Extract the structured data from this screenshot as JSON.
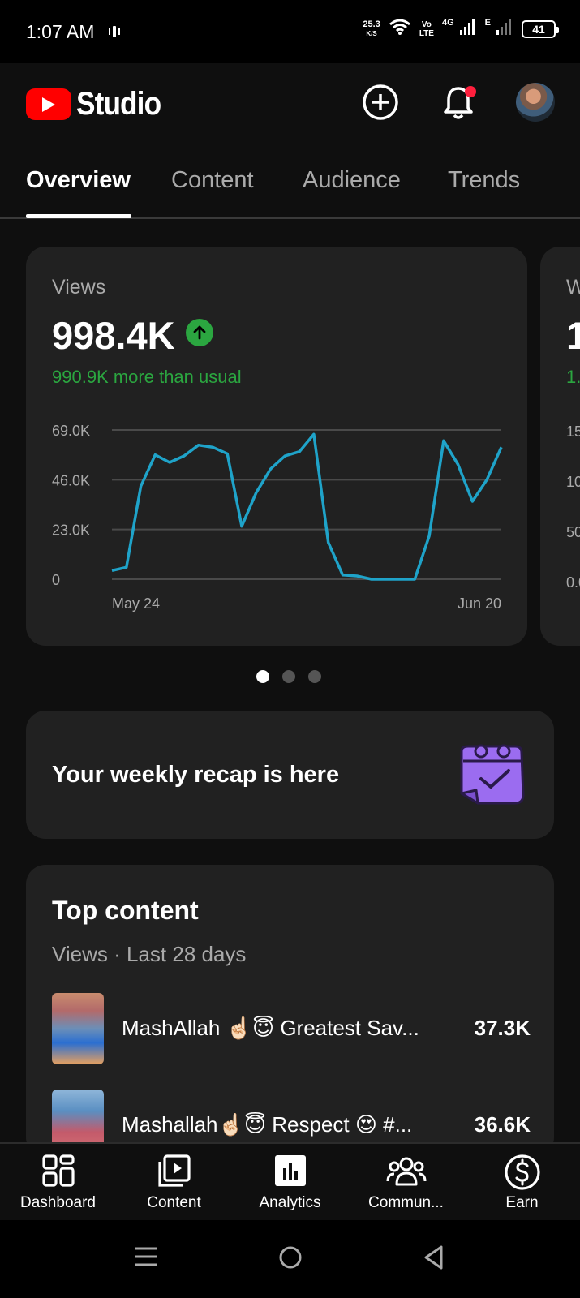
{
  "status_bar": {
    "time": "1:07 AM",
    "speed_value": "25.3",
    "speed_unit": "K/S",
    "volte_top": "Vo",
    "volte_bottom": "LTE",
    "net_4g": "4G",
    "net_e": "E",
    "battery": "41",
    "icons": [
      "vibrate-icon",
      "wifi-icon",
      "signal-icon",
      "battery-icon"
    ]
  },
  "app": {
    "logo_text": "Studio",
    "brand_color": "#ff0000",
    "icons": [
      "create-icon",
      "notification-bell-icon",
      "avatar"
    ]
  },
  "tabs": [
    {
      "label": "Overview",
      "active": true
    },
    {
      "label": "Content",
      "active": false
    },
    {
      "label": "Audience",
      "active": false
    },
    {
      "label": "Trends",
      "active": false
    }
  ],
  "metric": {
    "label": "Views",
    "value": "998.4K",
    "comparison": "990.9K more than usual",
    "trend": "up",
    "accent": "#2ba640",
    "line_color": "#1fa3c9"
  },
  "peek_card": {
    "label": "W",
    "value": "1",
    "comparison": "1.",
    "y_ticks": [
      "15",
      "10",
      "50",
      "0.0"
    ]
  },
  "chart_data": {
    "type": "line",
    "title": "",
    "y_tick_labels": [
      "69.0K",
      "46.0K",
      "23.0K",
      "0"
    ],
    "ylim": [
      0,
      69000
    ],
    "x_tick_labels": [
      "May 24",
      "Jun 20"
    ],
    "x": [
      "May 24",
      "May 25",
      "May 26",
      "May 27",
      "May 28",
      "May 29",
      "May 30",
      "May 31",
      "Jun 1",
      "Jun 2",
      "Jun 3",
      "Jun 4",
      "Jun 5",
      "Jun 6",
      "Jun 7",
      "Jun 8",
      "Jun 9",
      "Jun 10",
      "Jun 11",
      "Jun 12",
      "Jun 13",
      "Jun 14",
      "Jun 15",
      "Jun 16",
      "Jun 17",
      "Jun 18",
      "Jun 19",
      "Jun 20"
    ],
    "series": [
      {
        "name": "",
        "values": [
          4000,
          5500,
          43000,
          57500,
          54000,
          57000,
          62000,
          61000,
          58000,
          24500,
          40000,
          51000,
          57000,
          59000,
          67000,
          17000,
          2000,
          1500,
          0,
          0,
          0,
          0,
          20000,
          64000,
          53000,
          36000,
          46000,
          61000
        ]
      }
    ],
    "grid": true,
    "legend": "none"
  },
  "carousel": {
    "count": 3,
    "active_index": 0
  },
  "recap": {
    "text": "Your weekly recap is here",
    "icon": "calendar-check-icon",
    "icon_color": "#9b6cf0"
  },
  "top_content": {
    "title": "Top content",
    "subtitle": "Views · Last 28 days",
    "items": [
      {
        "title": "MashAllah ☝🏻😇 Greatest Sav...",
        "views": "37.3K"
      },
      {
        "title": "Mashallah☝🏻😇 Respect 😍 #...",
        "views": "36.6K"
      }
    ]
  },
  "bottom_nav": [
    {
      "label": "Dashboard",
      "icon": "dashboard-icon"
    },
    {
      "label": "Content",
      "icon": "content-icon"
    },
    {
      "label": "Analytics",
      "icon": "analytics-icon",
      "active": true
    },
    {
      "label": "Commun...",
      "icon": "community-icon"
    },
    {
      "label": "Earn",
      "icon": "earn-icon"
    }
  ],
  "system_nav": [
    "menu-icon",
    "home-icon",
    "back-icon"
  ]
}
